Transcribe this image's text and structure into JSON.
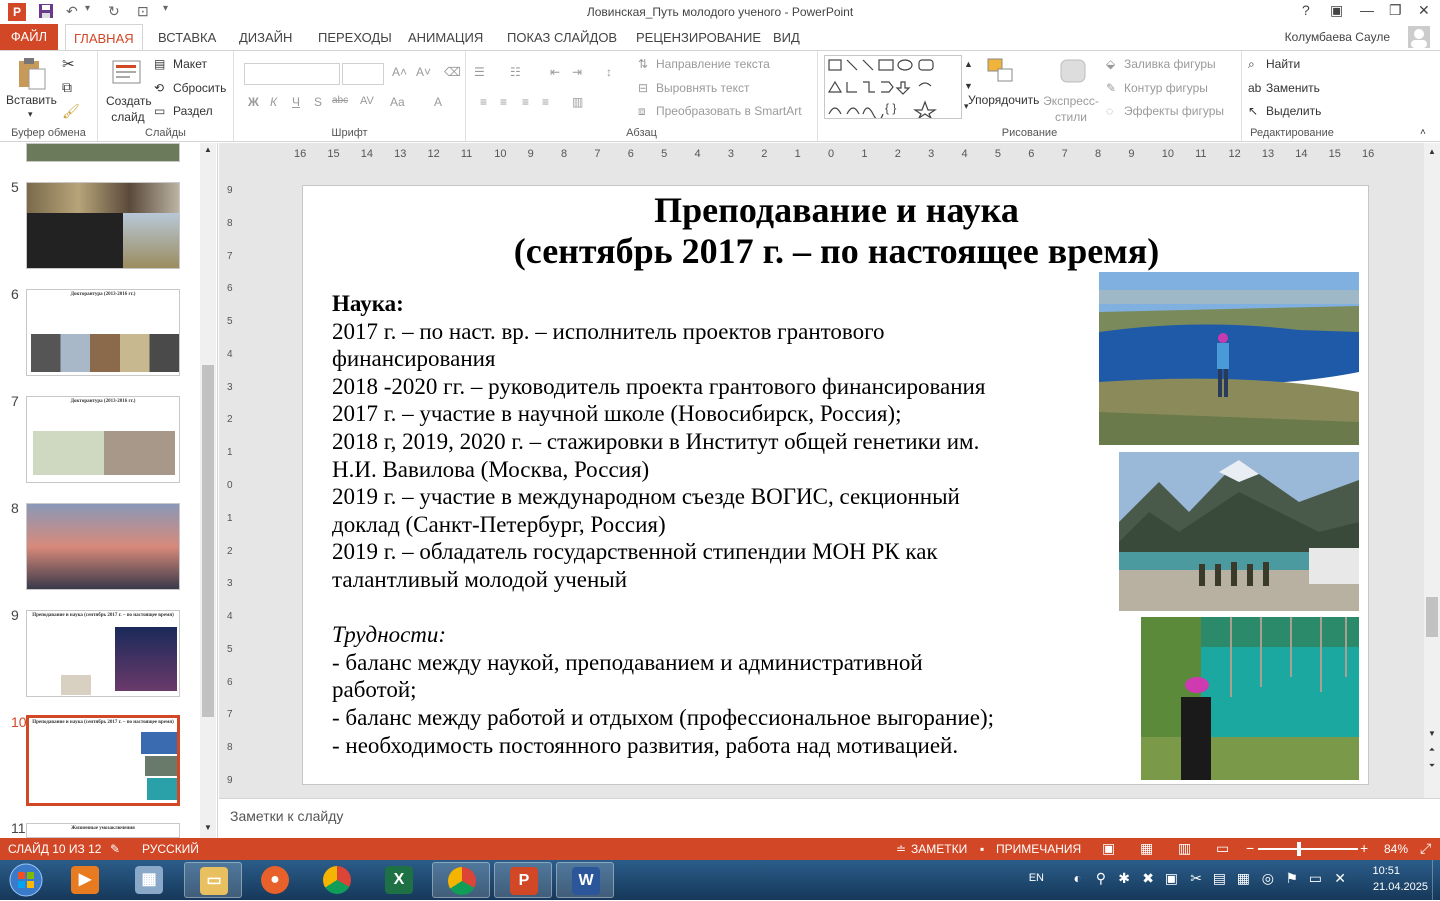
{
  "window": {
    "title": "Ловинская_Путь молодого ученого - PowerPoint",
    "help_glyph": "?",
    "minimize_glyph": "—",
    "restore_glyph": "❐",
    "close_glyph": "✕"
  },
  "ribbon_tabs": [
    "ФАЙЛ",
    "ГЛАВНАЯ",
    "ВСТАВКА",
    "ДИЗАЙН",
    "ПЕРЕХОДЫ",
    "АНИМАЦИЯ",
    "ПОКАЗ СЛАЙДОВ",
    "РЕЦЕНЗИРОВАНИЕ",
    "ВИД"
  ],
  "active_tab": "ГЛАВНАЯ",
  "user_name": "Колумбаева Сауле",
  "ribbon": {
    "clipboard": {
      "paste": "Вставить",
      "label": "Буфер обмена"
    },
    "slides": {
      "new_slide": "Создать слайд",
      "layout": "Макет",
      "reset": "Сбросить",
      "section": "Раздел",
      "label": "Слайды"
    },
    "font": {
      "label": "Шрифт",
      "bold": "Ж",
      "italic": "К",
      "underline": "Ч",
      "shadow": "S",
      "strike": "abc",
      "spacing": "AV",
      "case": "Aa",
      "color": "A"
    },
    "paragraph": {
      "label": "Абзац",
      "text_direction": "Направление текста",
      "align_text": "Выровнять текст",
      "smartart": "Преобразовать в SmartArt"
    },
    "drawing": {
      "label": "Рисование",
      "arrange": "Упорядочить",
      "quick_styles": "Экспресс-стили",
      "fill": "Заливка фигуры",
      "outline": "Контур фигуры",
      "effects": "Эффекты фигуры"
    },
    "editing": {
      "label": "Редактирование",
      "find": "Найти",
      "replace": "Заменить",
      "select": "Выделить"
    }
  },
  "thumbnails": [
    {
      "num": "5",
      "title": ""
    },
    {
      "num": "6",
      "title": "Докторантура (2013-2016 гг.)"
    },
    {
      "num": "7",
      "title": "Докторантура (2013-2016 гг.)"
    },
    {
      "num": "8",
      "title": ""
    },
    {
      "num": "9",
      "title": "Преподавание и наука (сентябрь 2017 г. – по настоящее время)"
    },
    {
      "num": "10",
      "title": "Преподавание и наука (сентябрь 2017 г. – по настоящее время)"
    },
    {
      "num": "11",
      "title": "Жизненные умозаключения"
    }
  ],
  "slide": {
    "title_line1": "Преподавание и наука",
    "title_line2": "(сентябрь 2017 г. – по настоящее время)",
    "heading": "Наука:",
    "lines": [
      "2017 г. – по наст. вр. – исполнитель проектов грантового",
      "финансирования",
      "2018 -2020 гг. – руководитель проекта грантового финансирования",
      "2017 г. – участие в научной школе (Новосибирск, Россия);",
      "2018 г, 2019, 2020 г. – стажировки в Институт общей генетики им.",
      "Н.И. Вавилова (Москва, Россия)",
      "2019 г. – участие в международном съезде ВОГИС, секционный",
      "доклад (Санкт-Петербург, Россия)",
      "2019 г. – обладатель государственной стипендии МОН РК как",
      "талантливый молодой ученый"
    ],
    "difficulties_heading": "Трудности:",
    "difficulties": [
      "- баланс между наукой, преподаванием и административной",
      "работой;",
      "- баланс между работой и отдыхом (профессиональное выгорание);",
      "- необходимость постоянного развития, работа над мотивацией."
    ]
  },
  "ruler": {
    "h_ticks": [
      "16",
      "15",
      "14",
      "13",
      "12",
      "11",
      "10",
      "9",
      "8",
      "7",
      "6",
      "5",
      "4",
      "3",
      "2",
      "1",
      "0",
      "1",
      "2",
      "3",
      "4",
      "5",
      "6",
      "7",
      "8",
      "9",
      "10",
      "11",
      "12",
      "13",
      "14",
      "15",
      "16"
    ],
    "v_ticks": [
      "9",
      "8",
      "7",
      "6",
      "5",
      "4",
      "3",
      "2",
      "1",
      "0",
      "1",
      "2",
      "3",
      "4",
      "5",
      "6",
      "7",
      "8",
      "9"
    ]
  },
  "notes_placeholder": "Заметки к слайду",
  "status": {
    "slide_info": "СЛАЙД 10 ИЗ 12",
    "language": "РУССКИЙ",
    "notes": "ЗАМЕТКИ",
    "comments": "ПРИМЕЧАНИЯ",
    "zoom": "84%"
  },
  "taskbar": {
    "lang": "EN",
    "time": "10:51",
    "date": "21.04.2025"
  },
  "colors": {
    "accent": "#d24726",
    "ribbon_bg": "#ffffff",
    "editor_bg": "#e6e6e6"
  }
}
